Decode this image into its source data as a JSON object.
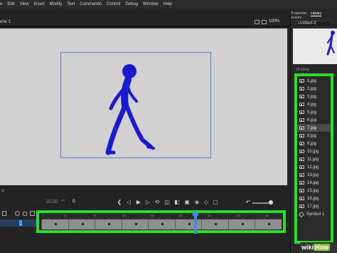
{
  "menu": [
    "e",
    "Edit",
    "View",
    "Insert",
    "Modify",
    "Text",
    "Commands",
    "Control",
    "Debug",
    "Window",
    "Help"
  ],
  "scene": {
    "label": "ene 1",
    "zoom": "100%"
  },
  "panel": {
    "tabs": [
      "Properties",
      "Library",
      "Assets"
    ],
    "doc_name": "Untitled-9",
    "items_count": "18 items",
    "items": [
      "1.jpg",
      "2.jpg",
      "3.jpg",
      "4.jpg",
      "5.jpg",
      "6.jpg",
      "7.jpg",
      "8.jpg",
      "9.jpg",
      "10.jpg",
      "11.jpg",
      "12.jpg",
      "13.jpg",
      "14.jpg",
      "15.jpg",
      "16.jpg",
      "17.jpg",
      "Symbol 1"
    ],
    "selected_item": "7.jpg"
  },
  "timeline": {
    "label": "ut",
    "time": "10.00",
    "fps": "fps",
    "frame": "6",
    "ruler": [
      "1",
      "5",
      "10",
      "15",
      "20",
      "25",
      "30",
      "35",
      "40"
    ]
  },
  "colors": {
    "highlight": "#25e025",
    "figure": "#1a1ad0",
    "playhead": "#3b8de0"
  },
  "watermark": {
    "wiki": "wiki",
    "how": "How"
  }
}
